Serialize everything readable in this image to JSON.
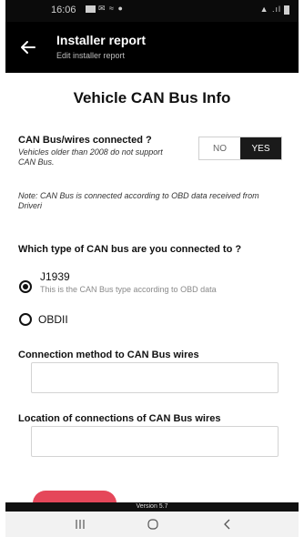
{
  "status_bar": {
    "time": "16:06",
    "indicators": "✉ ≈ ●",
    "signal": "▲ .ıl"
  },
  "app_bar": {
    "back_icon": "arrow-left-icon",
    "title": "Installer report",
    "subtitle": "Edit installer report"
  },
  "section": {
    "title": "Vehicle CAN Bus Info"
  },
  "can_connected": {
    "label": "CAN Bus/wires connected ?",
    "hint": "Vehicles older than 2008 do not support CAN Bus.",
    "options": [
      "NO",
      "YES"
    ],
    "selected": "YES"
  },
  "note": "Note: CAN Bus is connected according to OBD data received from Driveri",
  "can_type": {
    "question": "Which type of CAN bus are you connected to ?",
    "options": [
      {
        "label": "J1939",
        "hint": "This is the CAN Bus type according to OBD data",
        "checked": true
      },
      {
        "label": "OBDII",
        "hint": "",
        "checked": false
      }
    ]
  },
  "connection_method": {
    "label": "Connection method to CAN Bus wires",
    "value": ""
  },
  "connection_location": {
    "label": "Location of connections of CAN Bus wires",
    "value": ""
  },
  "footer": {
    "version": "Version 5.7"
  },
  "colors": {
    "accent": "#e5475a",
    "appbar": "#000000",
    "selected_toggle": "#1a1a1a"
  }
}
